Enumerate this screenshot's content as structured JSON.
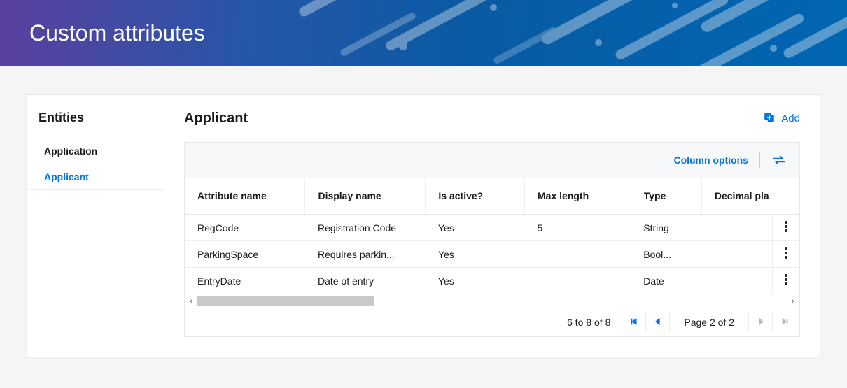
{
  "banner": {
    "title": "Custom attributes"
  },
  "sidebar": {
    "heading": "Entities",
    "items": [
      {
        "label": "Application",
        "active": false
      },
      {
        "label": "Applicant",
        "active": true
      }
    ]
  },
  "main": {
    "title": "Applicant",
    "add_label": "Add",
    "toolbar": {
      "column_options": "Column options"
    },
    "columns": [
      "Attribute name",
      "Display name",
      "Is active?",
      "Max length",
      "Type",
      "Decimal pla"
    ],
    "rows": [
      {
        "attr": "RegCode",
        "display": "Registration Code",
        "active": "Yes",
        "max": "5",
        "type": "String",
        "dec": ""
      },
      {
        "attr": "ParkingSpace",
        "display": "Requires parkin...",
        "active": "Yes",
        "max": "",
        "type": "Bool...",
        "dec": ""
      },
      {
        "attr": "EntryDate",
        "display": "Date of entry",
        "active": "Yes",
        "max": "",
        "type": "Date",
        "dec": ""
      }
    ],
    "pager": {
      "range": "6 to 8 of 8",
      "page_label": "Page 2 of 2"
    }
  }
}
